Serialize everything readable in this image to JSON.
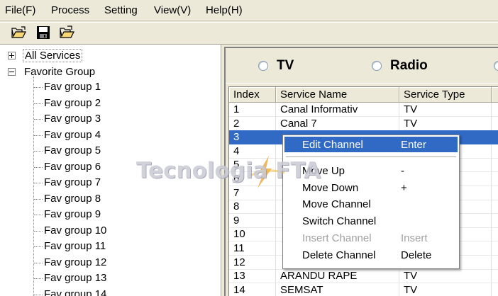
{
  "menubar": {
    "items": [
      "File(F)",
      "Process",
      "Setting",
      "View(V)",
      "Help(H)"
    ]
  },
  "toolbar": {
    "buttons": [
      "open-folder-icon",
      "save-icon",
      "open-file-icon"
    ]
  },
  "tree": {
    "all_services": "All Services",
    "favorite_group": "Favorite Group",
    "groups": [
      "Fav group 1",
      "Fav group 2",
      "Fav group 3",
      "Fav group 4",
      "Fav group 5",
      "Fav group 6",
      "Fav group 7",
      "Fav group 8",
      "Fav group 9",
      "Fav group 10",
      "Fav group 11",
      "Fav group 12",
      "Fav group 13",
      "Fav group 14"
    ]
  },
  "radios": {
    "tv": "TV",
    "radio": "Radio"
  },
  "table": {
    "columns": [
      "Index",
      "Service Name",
      "Service Type"
    ],
    "rows": [
      {
        "index": "1",
        "name": "Canal Informativ",
        "type": "TV"
      },
      {
        "index": "2",
        "name": "Canal 7",
        "type": "TV"
      },
      {
        "index": "3",
        "name": "",
        "type": ""
      },
      {
        "index": "4",
        "name": "",
        "type": ""
      },
      {
        "index": "5",
        "name": "",
        "type": ""
      },
      {
        "index": "6",
        "name": "",
        "type": ""
      },
      {
        "index": "7",
        "name": "",
        "type": ""
      },
      {
        "index": "8",
        "name": "",
        "type": ""
      },
      {
        "index": "9",
        "name": "",
        "type": ""
      },
      {
        "index": "10",
        "name": "",
        "type": ""
      },
      {
        "index": "11",
        "name": "",
        "type": ""
      },
      {
        "index": "12",
        "name": "",
        "type": ""
      },
      {
        "index": "13",
        "name": "ARANDU RAPE",
        "type": "TV"
      },
      {
        "index": "14",
        "name": "SEMSAT",
        "type": "TV"
      }
    ],
    "selected_index": 2
  },
  "context_menu": {
    "edit_channel": {
      "label": "Edit Channel",
      "key": "Enter"
    },
    "move_up": {
      "label": "Move Up",
      "key": "-"
    },
    "move_down": {
      "label": "Move Down",
      "key": "+"
    },
    "move_channel": {
      "label": "Move Channel",
      "key": ""
    },
    "switch_channel": {
      "label": "Switch Channel",
      "key": ""
    },
    "insert_channel": {
      "label": "Insert Channel",
      "key": "Insert"
    },
    "delete_channel": {
      "label": "Delete Channel",
      "key": "Delete"
    }
  },
  "watermark": {
    "text": "Tecnologia FTA"
  },
  "colors": {
    "selection": "#316ac5",
    "chrome": "#ece9d8"
  }
}
